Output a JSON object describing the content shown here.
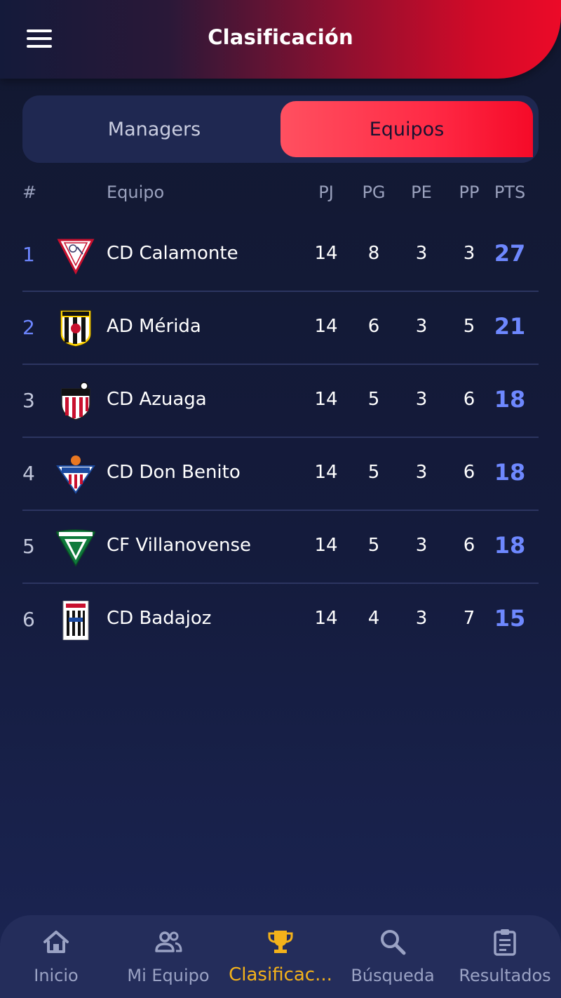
{
  "header": {
    "title": "Clasificación"
  },
  "tabs": [
    {
      "label": "Managers",
      "active": false
    },
    {
      "label": "Equipos",
      "active": true
    }
  ],
  "table": {
    "headers": {
      "pos": "#",
      "team": "Equipo",
      "pj": "PJ",
      "pg": "PG",
      "pe": "PE",
      "pp": "PP",
      "pts": "PTS"
    },
    "rows": [
      {
        "pos": "1",
        "team": "CD Calamonte",
        "pj": "14",
        "pg": "8",
        "pe": "3",
        "pp": "3",
        "pts": "27"
      },
      {
        "pos": "2",
        "team": "AD Mérida",
        "pj": "14",
        "pg": "6",
        "pe": "3",
        "pp": "5",
        "pts": "21"
      },
      {
        "pos": "3",
        "team": "CD Azuaga",
        "pj": "14",
        "pg": "5",
        "pe": "3",
        "pp": "6",
        "pts": "18"
      },
      {
        "pos": "4",
        "team": "CD Don Benito",
        "pj": "14",
        "pg": "5",
        "pe": "3",
        "pp": "6",
        "pts": "18"
      },
      {
        "pos": "5",
        "team": "CF Villanovense",
        "pj": "14",
        "pg": "5",
        "pe": "3",
        "pp": "6",
        "pts": "18"
      },
      {
        "pos": "6",
        "team": "CD Badajoz",
        "pj": "14",
        "pg": "4",
        "pe": "3",
        "pp": "7",
        "pts": "15"
      }
    ]
  },
  "nav": [
    {
      "label": "Inicio",
      "icon": "home-icon",
      "active": false
    },
    {
      "label": "Mi Equipo",
      "icon": "team-icon",
      "active": false
    },
    {
      "label": "Clasificac...",
      "icon": "trophy-icon",
      "active": true
    },
    {
      "label": "Búsqueda",
      "icon": "search-icon",
      "active": false
    },
    {
      "label": "Resultados",
      "icon": "clipboard-icon",
      "active": false
    }
  ],
  "colors": {
    "accent_red": "#ff2a45",
    "points_blue": "#6e88ff",
    "nav_active": "#f4b21a",
    "background": "#141b3c"
  }
}
